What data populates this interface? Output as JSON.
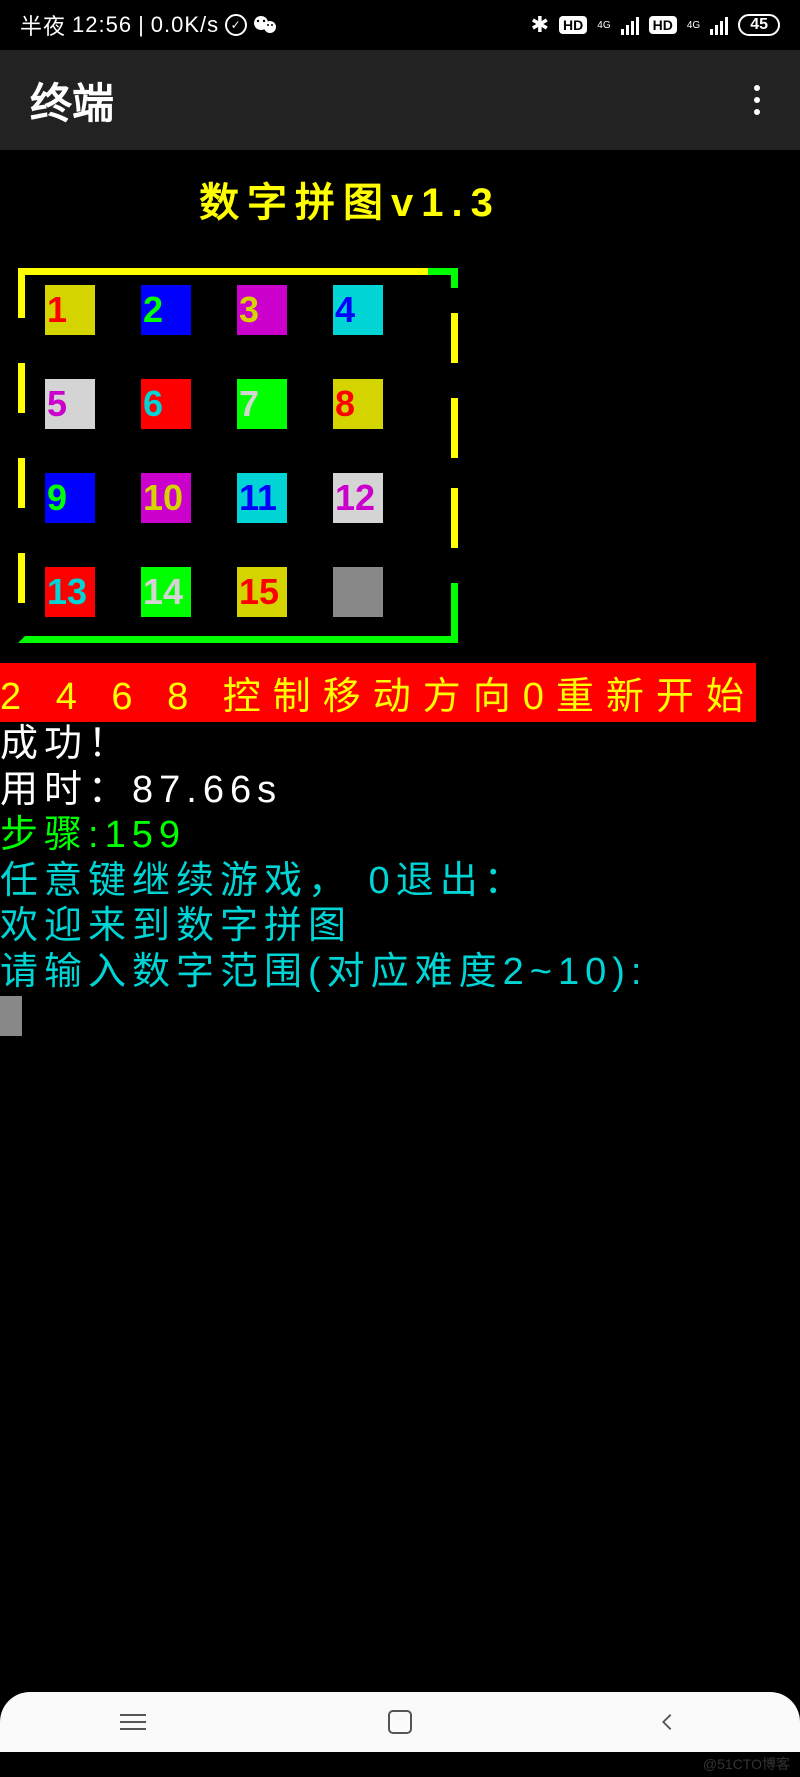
{
  "status_bar": {
    "time_prefix": "半夜",
    "time": "12:56",
    "speed": "0.0K/s",
    "battery": "45"
  },
  "app": {
    "title": "终端"
  },
  "game": {
    "title": "数字拼图v1.3",
    "tiles": [
      {
        "n": "1",
        "bg": "#d4d400",
        "fg": "#ff0000"
      },
      {
        "n": "2",
        "bg": "#0000ff",
        "fg": "#00ff00"
      },
      {
        "n": "3",
        "bg": "#cc00cc",
        "fg": "#d4d400"
      },
      {
        "n": "4",
        "bg": "#00d4d4",
        "fg": "#0000ff"
      },
      {
        "n": "5",
        "bg": "#d4d4d4",
        "fg": "#cc00cc"
      },
      {
        "n": "6",
        "bg": "#ff0000",
        "fg": "#00d4d4"
      },
      {
        "n": "7",
        "bg": "#00ff00",
        "fg": "#d4d4d4"
      },
      {
        "n": "8",
        "bg": "#d4d400",
        "fg": "#ff0000"
      },
      {
        "n": "9",
        "bg": "#0000ff",
        "fg": "#00ff00"
      },
      {
        "n": "10",
        "bg": "#cc00cc",
        "fg": "#d4d400"
      },
      {
        "n": "11",
        "bg": "#00d4d4",
        "fg": "#0000ff"
      },
      {
        "n": "12",
        "bg": "#d4d4d4",
        "fg": "#cc00cc"
      },
      {
        "n": "13",
        "bg": "#ff0000",
        "fg": "#00d4d4"
      },
      {
        "n": "14",
        "bg": "#00ff00",
        "fg": "#d4d4d4"
      },
      {
        "n": "15",
        "bg": "#d4d400",
        "fg": "#ff0000"
      },
      {
        "n": "",
        "bg": "#888",
        "fg": "#000"
      }
    ],
    "controls": "2 4 6 8 控制移动方向0重新开始",
    "success": "成功！",
    "time_label": "用时：",
    "time_value": "87.66s",
    "steps_label": "步骤:",
    "steps_value": "159",
    "continue_prompt": "任意键继续游戏， 0退出：",
    "welcome": "欢迎来到数字拼图",
    "range_prompt": "请输入数字范围(对应难度2~10):"
  },
  "watermark": "@51CTO博客"
}
